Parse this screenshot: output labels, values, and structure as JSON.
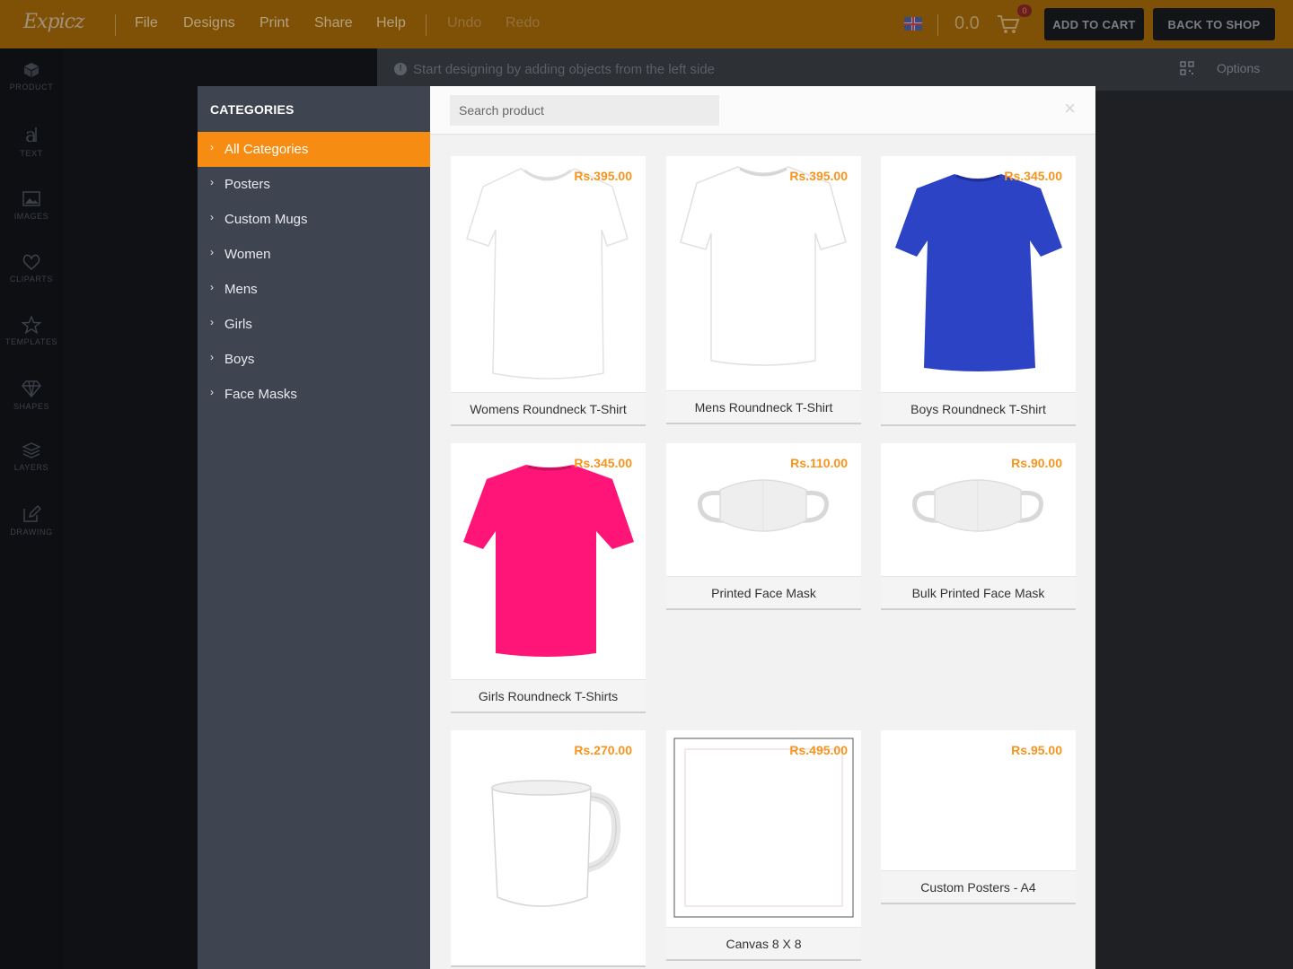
{
  "app": {
    "logo_text": "Expicz"
  },
  "topbar": {
    "menu": [
      {
        "label": "File",
        "enabled": true
      },
      {
        "label": "Designs",
        "enabled": true
      },
      {
        "label": "Print",
        "enabled": true
      },
      {
        "label": "Share",
        "enabled": true
      },
      {
        "label": "Help",
        "enabled": true
      },
      {
        "label": "Undo",
        "enabled": false
      },
      {
        "label": "Redo",
        "enabled": false
      }
    ],
    "language_icon": "uk-flag-icon",
    "cart_total": "0.0",
    "cart_count": "0",
    "add_to_cart_label": "ADD TO CART",
    "back_to_shop_label": "BACK TO SHOP"
  },
  "tools": [
    {
      "label": "PRODUCT",
      "icon": "cube-icon"
    },
    {
      "label": "TEXT",
      "icon": "text-icon"
    },
    {
      "label": "IMAGES",
      "icon": "image-icon"
    },
    {
      "label": "CLIPARTS",
      "icon": "heart-icon"
    },
    {
      "label": "TEMPLATES",
      "icon": "star-icon"
    },
    {
      "label": "SHAPES",
      "icon": "diamond-icon"
    },
    {
      "label": "LAYERS",
      "icon": "layers-icon"
    },
    {
      "label": "DRAWING",
      "icon": "pencil-icon"
    }
  ],
  "stage": {
    "hint": "Start designing by adding objects from the left side",
    "options_label": "Options"
  },
  "modal": {
    "categories_title": "CATEGORIES",
    "categories": [
      {
        "label": "All Categories",
        "active": true
      },
      {
        "label": "Posters",
        "active": false
      },
      {
        "label": "Custom Mugs",
        "active": false
      },
      {
        "label": "Women",
        "active": false
      },
      {
        "label": "Mens",
        "active": false
      },
      {
        "label": "Girls",
        "active": false
      },
      {
        "label": "Boys",
        "active": false
      },
      {
        "label": "Face Masks",
        "active": false
      }
    ],
    "search": {
      "placeholder": "Search product",
      "value": ""
    },
    "close_symbol": "×",
    "products": [
      {
        "name": "Womens Roundneck T-Shirt",
        "price": "Rs.395.00",
        "image": "white-tshirt-women",
        "color": "#ffffff"
      },
      {
        "name": "Mens Roundneck T-Shirt",
        "price": "Rs.395.00",
        "image": "white-tshirt-men",
        "color": "#ffffff"
      },
      {
        "name": "Boys Roundneck T-Shirt",
        "price": "Rs.345.00",
        "image": "blue-tshirt",
        "color": "#2b43c4"
      },
      {
        "name": "Girls Roundneck T-Shirts",
        "price": "Rs.345.00",
        "image": "pink-tshirt",
        "color": "#ff1577"
      },
      {
        "name": "Printed Face Mask",
        "price": "Rs.110.00",
        "image": "face-mask",
        "color": "#f0f0f0"
      },
      {
        "name": "Bulk Printed Face Mask",
        "price": "Rs.90.00",
        "image": "face-mask",
        "color": "#f0f0f0"
      },
      {
        "name": "",
        "price": "Rs.270.00",
        "image": "white-mug",
        "color": "#ffffff"
      },
      {
        "name": "Canvas 8 X 8",
        "price": "Rs.495.00",
        "image": "canvas-frame",
        "color": "#ffffff"
      },
      {
        "name": "Custom Posters - A4",
        "price": "Rs.95.00",
        "image": "blank-poster",
        "color": "#ffffff"
      }
    ]
  }
}
